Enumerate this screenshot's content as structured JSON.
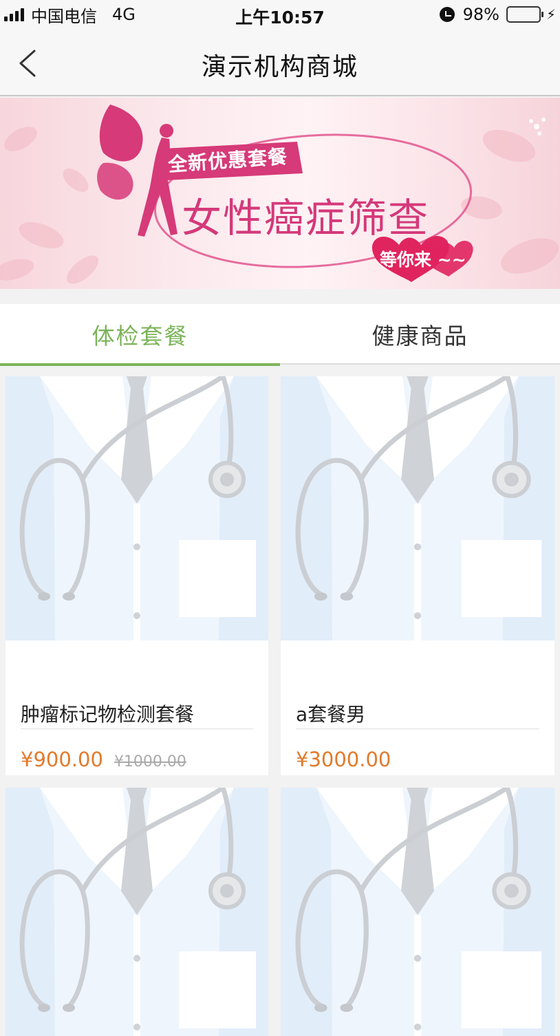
{
  "status_bar": {
    "carrier": "中国电信",
    "network": "4G",
    "time": "上午10:57",
    "battery_percent": "98%",
    "battery_level": 0.98,
    "icons": [
      "signal-icon",
      "alarm-icon",
      "battery-icon",
      "charging-icon"
    ]
  },
  "nav": {
    "title": "演示机构商城",
    "back_icon": "chevron-left-icon"
  },
  "banner": {
    "subtitle": "全新优惠套餐",
    "title": "女性癌症筛查",
    "tag": "等你来 ~~"
  },
  "tabs": [
    {
      "label": "体检套餐",
      "active": true
    },
    {
      "label": "健康商品",
      "active": false
    }
  ],
  "colors": {
    "accent": "#7cb45a",
    "price": "#e27a2c",
    "banner_title": "#d4397a"
  },
  "products": [
    {
      "name": "肿瘤标记物检测套餐",
      "price": "¥900.00",
      "original_price": "¥1000.00"
    },
    {
      "name": "a套餐男",
      "price": "¥3000.00",
      "original_price": ""
    },
    {
      "name": "",
      "price": "",
      "original_price": ""
    },
    {
      "name": "",
      "price": "",
      "original_price": ""
    }
  ]
}
